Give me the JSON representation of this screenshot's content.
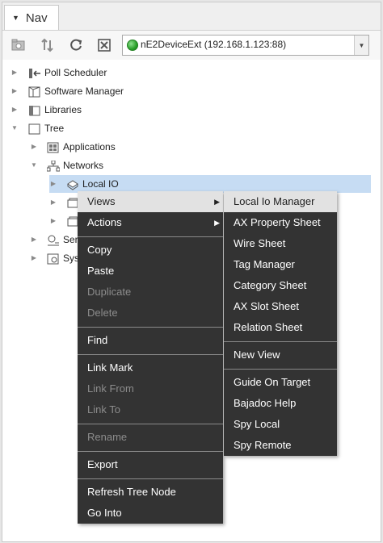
{
  "nav": {
    "title": "Nav"
  },
  "toolbar": {
    "buttons": [
      "new-folder-icon",
      "sort-icon",
      "refresh-icon",
      "close-icon"
    ],
    "station_select": {
      "value": "nE2DeviceExt (192.168.1.123:88)"
    }
  },
  "tree": {
    "poll_scheduler": "Poll Scheduler",
    "software_manager": "Software Manager",
    "libraries": "Libraries",
    "tree": "Tree",
    "applications": "Applications",
    "networks": "Networks",
    "local_io": "Local IO",
    "services_partial": "Serv",
    "system_partial": "Syst"
  },
  "context_menu": {
    "views": "Views",
    "actions": "Actions",
    "copy": "Copy",
    "paste": "Paste",
    "duplicate": "Duplicate",
    "delete": "Delete",
    "find": "Find",
    "link_mark": "Link Mark",
    "link_from": "Link From",
    "link_to": "Link To",
    "rename": "Rename",
    "export": "Export",
    "refresh_tree_node": "Refresh Tree Node",
    "go_into": "Go Into"
  },
  "views_submenu": {
    "local_io_manager": "Local Io Manager",
    "ax_property_sheet": "AX Property Sheet",
    "wire_sheet": "Wire Sheet",
    "tag_manager": "Tag Manager",
    "category_sheet": "Category Sheet",
    "ax_slot_sheet": "AX Slot Sheet",
    "relation_sheet": "Relation Sheet",
    "new_view": "New View",
    "guide_on_target": "Guide On Target",
    "bajadoc_help": "Bajadoc Help",
    "spy_local": "Spy Local",
    "spy_remote": "Spy Remote"
  }
}
